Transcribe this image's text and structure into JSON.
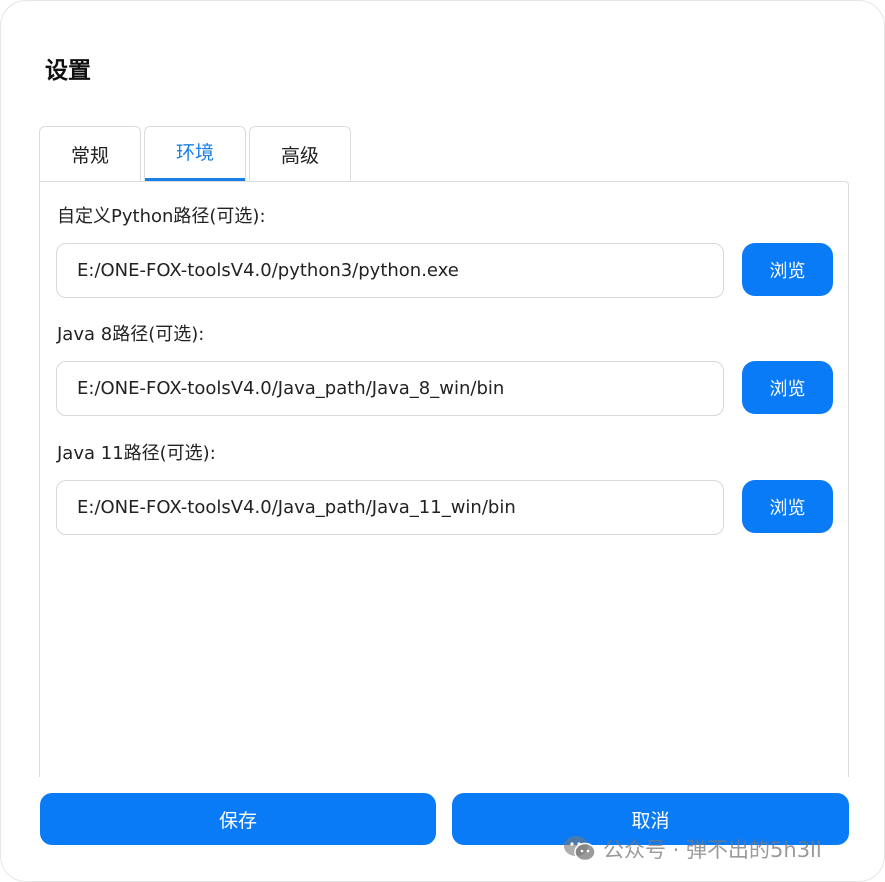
{
  "dialog": {
    "title": "设置"
  },
  "tabs": [
    {
      "label": "常规",
      "active": false
    },
    {
      "label": "环境",
      "active": true
    },
    {
      "label": "高级",
      "active": false
    }
  ],
  "env": {
    "python": {
      "label": "自定义Python路径(可选):",
      "value": "E:/ONE-FOX-toolsV4.0/python3/python.exe",
      "browse_label": "浏览"
    },
    "java8": {
      "label": "Java 8路径(可选):",
      "value": "E:/ONE-FOX-toolsV4.0/Java_path/Java_8_win/bin",
      "browse_label": "浏览"
    },
    "java11": {
      "label": "Java 11路径(可选):",
      "value": "E:/ONE-FOX-toolsV4.0/Java_path/Java_11_win/bin",
      "browse_label": "浏览"
    }
  },
  "footer": {
    "save_label": "保存",
    "cancel_label": "取消"
  },
  "watermark": {
    "icon": "wechat-icon",
    "text": "公众号 · 弹不出的5h3ll"
  },
  "colors": {
    "accent": "#0a7bf7",
    "tab_active": "#1a7fe8",
    "border": "#dcdcdc"
  }
}
